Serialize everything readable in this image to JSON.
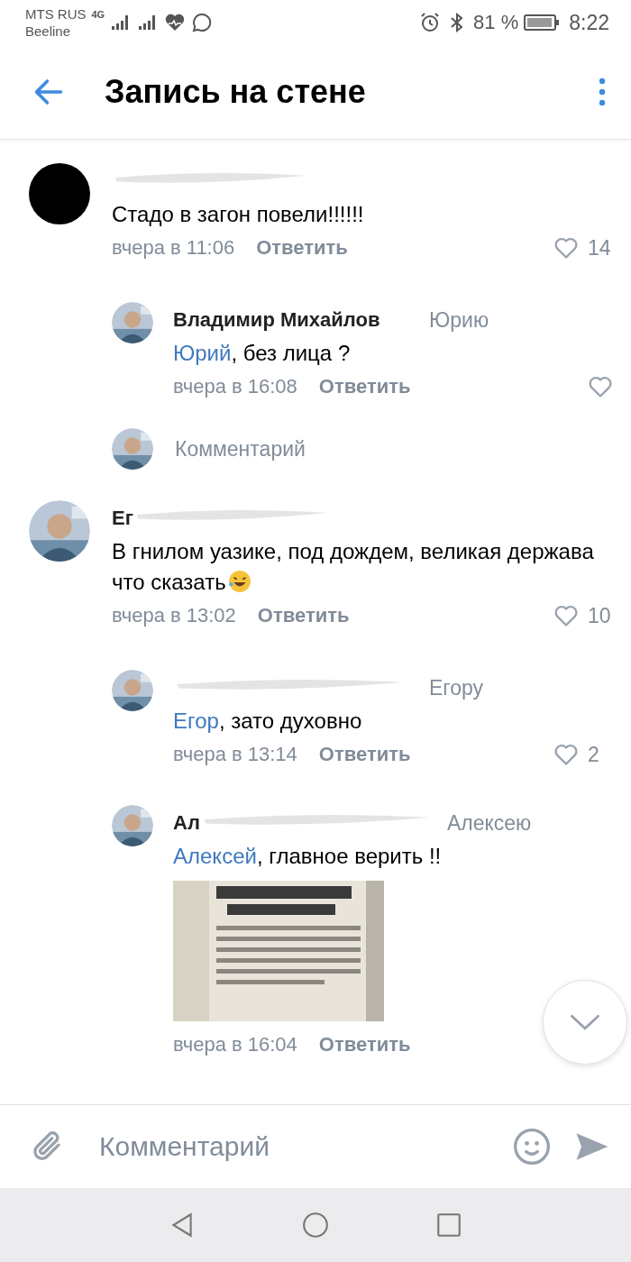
{
  "status_bar": {
    "carrier": "MTS RUS",
    "carrier_2": "Beeline",
    "network": "4G",
    "battery": "81 %",
    "time": "8:22"
  },
  "header": {
    "title": "Запись на стене"
  },
  "threads": [
    {
      "comment": {
        "avatar": {
          "kind": "plain"
        },
        "name_redacted": true,
        "text": "Стадо в загон повели!!!!!!",
        "show_like": true,
        "time": "вчера в 11:06",
        "reply_label": "Ответить",
        "likes": "14"
      },
      "children": [
        {
          "author": "Владимир Михайлов",
          "name_redacted": false,
          "reply_to": "Юрию",
          "mention": "Юрий",
          "text": ", без лица ?",
          "show_like": true,
          "time": "вчера в 16:08",
          "reply_label": "Ответить"
        }
      ],
      "prompt": {
        "placeholder": "Комментарий"
      }
    },
    {
      "comment": {
        "author": "Ег",
        "name_redacted": true,
        "text": "В гнилом уазике, под дождем, великая держава что сказать",
        "emoji_after": true,
        "show_like": true,
        "time": "вчера в 13:02",
        "reply_label": "Ответить",
        "likes": "10"
      },
      "children": [
        {
          "name_redacted": true,
          "reply_to": "Егору",
          "mention": "Егор",
          "text": ", зато духовно",
          "show_like": true,
          "time": "вчера в 13:14",
          "reply_label": "Ответить",
          "likes": "2"
        },
        {
          "author": "Ал",
          "name_redacted": true,
          "reply_to": "Алексею",
          "mention": "Алексей",
          "text": ", главное верить !!",
          "show_like": false,
          "time": "вчера в 16:04",
          "reply_label": "Ответить"
        }
      ]
    }
  ],
  "composer": {
    "placeholder": "Комментарий"
  }
}
